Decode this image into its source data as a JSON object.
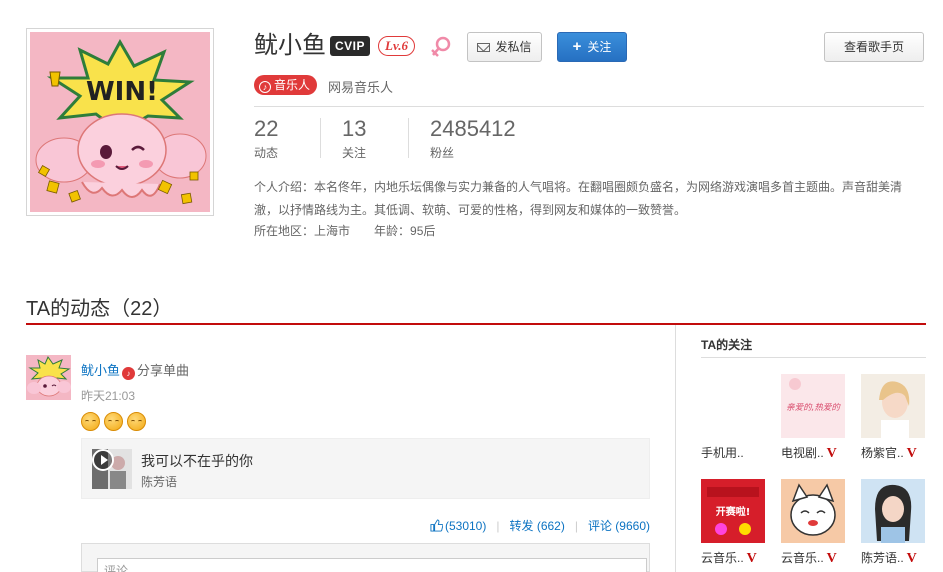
{
  "profile": {
    "name": "鱿小鱼",
    "vip_label": "CVIP",
    "level_label": "Lv.6",
    "gender": "female",
    "musician_tag": "音乐人",
    "musician_text": "网易音乐人",
    "buttons": {
      "message": "发私信",
      "follow": "关注",
      "homepage": "查看歌手页"
    },
    "stats": [
      {
        "value": "22",
        "label": "动态"
      },
      {
        "value": "13",
        "label": "关注"
      },
      {
        "value": "2485412",
        "label": "粉丝"
      }
    ],
    "intro": "个人介绍：本名佟年，内地乐坛偶像与实力兼备的人气唱将。在翻唱圈颇负盛名，为网络游戏演唱多首主题曲。声音甜美清澈，以抒情路线为主。其低调、软萌、可爱的性格，得到网友和媒体的一致赞誉。",
    "location": "所在地区：上海市",
    "age": "年龄：95后",
    "avatar_text": "WIN!"
  },
  "feed": {
    "title": "TA的动态（22）",
    "post": {
      "user": "鱿小鱼",
      "action": "分享单曲",
      "time": "昨天21:03",
      "song_title": "我可以不在乎的你",
      "song_artist": "陈芳语",
      "likes": "(53010)",
      "forward": "转发 (662)",
      "comment": "评论 (9660)",
      "comment_placeholder": "评论"
    }
  },
  "sidebar": {
    "title": "TA的关注",
    "items": [
      {
        "name": "手机用..",
        "verified": false,
        "thumb_text": ""
      },
      {
        "name": "电视剧..",
        "verified": true,
        "thumb_text": "亲爱的,热爱的"
      },
      {
        "name": "杨紫官..",
        "verified": true,
        "thumb_text": ""
      },
      {
        "name": "云音乐..",
        "verified": true,
        "thumb_text": "开赛啦!"
      },
      {
        "name": "云音乐..",
        "verified": true,
        "thumb_text": ""
      },
      {
        "name": "陈芳语..",
        "verified": true,
        "thumb_text": ""
      }
    ],
    "verified_mark": "V"
  },
  "colors": {
    "brand_red": "#c20c0c",
    "link_blue": "#0c73c2",
    "follow_blue": "#2670c2"
  }
}
